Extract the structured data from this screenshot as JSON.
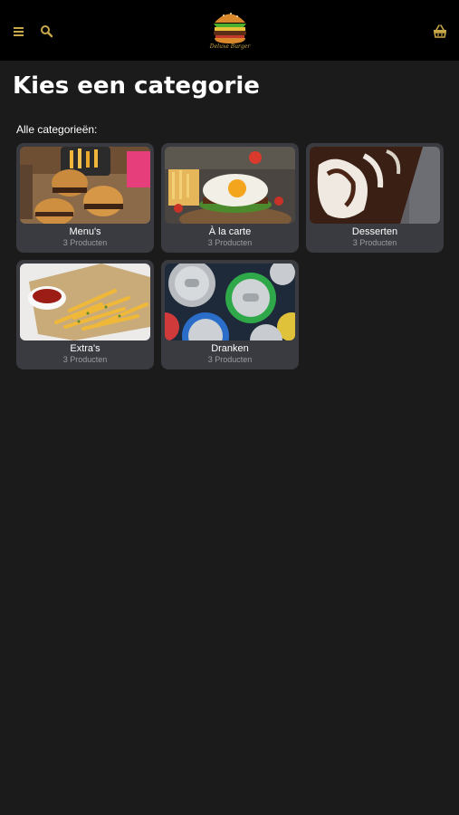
{
  "header": {
    "menu_icon": "hamburger-icon",
    "search_icon": "search-icon",
    "basket_icon": "basket-icon",
    "logo_text": "Deluxe Burger",
    "accent": "#c9a84a"
  },
  "page": {
    "title": "Kies een categorie",
    "section_label": "Alle categorieën:"
  },
  "categories": [
    {
      "name": "Menu's",
      "count": "3 Producten"
    },
    {
      "name": "À la carte",
      "count": "3 Producten"
    },
    {
      "name": "Desserten",
      "count": "3 Producten"
    },
    {
      "name": "Extra's",
      "count": "3 Producten"
    },
    {
      "name": "Dranken",
      "count": "3 Producten"
    }
  ]
}
